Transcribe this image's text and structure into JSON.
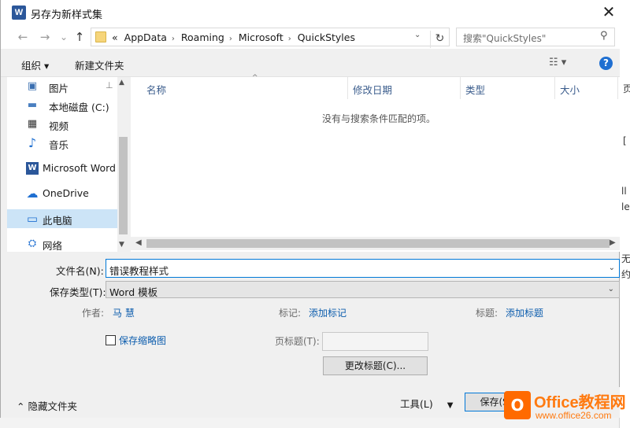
{
  "window": {
    "title": "另存为新样式集",
    "app_icon_letter": "W",
    "close_symbol": "✕"
  },
  "nav": {
    "back": "←",
    "forward": "→",
    "recent": "⌄",
    "up": "↑",
    "crumb_prefix": "«",
    "crumbs": [
      "AppData",
      "Roaming",
      "Microsoft",
      "QuickStyles"
    ],
    "refresh": "↻",
    "search_placeholder": "搜索\"QuickStyles\""
  },
  "toolbar": {
    "organize": "组织 ▾",
    "new_folder": "新建文件夹",
    "view_icon": "☷ ▾",
    "help": "?"
  },
  "sidebar": {
    "items": [
      {
        "label": "图片",
        "icon": "pictures-icon",
        "glyph": "▣"
      },
      {
        "label": "本地磁盘 (C:)",
        "icon": "drive-icon",
        "glyph": "▬"
      },
      {
        "label": "视频",
        "icon": "video-icon",
        "glyph": "▦"
      },
      {
        "label": "音乐",
        "icon": "music-icon",
        "glyph": "♪"
      },
      {
        "label": "Microsoft Word",
        "icon": "word-icon",
        "glyph": "W"
      },
      {
        "label": "OneDrive",
        "icon": "onedrive-icon",
        "glyph": "☁"
      },
      {
        "label": "此电脑",
        "icon": "computer-icon",
        "glyph": "▭"
      },
      {
        "label": "网络",
        "icon": "network-icon",
        "glyph": "⛭"
      }
    ],
    "pin_glyph": "📌"
  },
  "filelist": {
    "columns": [
      "名称",
      "修改日期",
      "类型",
      "大小"
    ],
    "empty_message": "没有与搜索条件匹配的项。"
  },
  "form": {
    "filename_label": "文件名(N):",
    "filename_value": "错误教程样式",
    "filetype_label": "保存类型(T):",
    "filetype_value": "Word 模板",
    "author_label": "作者:",
    "author_value": "马 慧",
    "tags_label": "标记:",
    "tags_value": "添加标记",
    "title_label": "标题:",
    "title_value": "添加标题",
    "thumbnail_label": "保存缩略图",
    "page_title_label": "页标题(T):",
    "change_title_button": "更改标题(C)..."
  },
  "bottom": {
    "hide_folders": "隐藏文件夹",
    "tools": "工具(L)",
    "save": "保存(S)"
  },
  "background": {
    "right_chars": [
      "页",
      "[",
      "ll",
      "le",
      "无",
      "约"
    ]
  },
  "watermark": {
    "logo_letter": "O",
    "text": "Office教程网",
    "url": "www.office26.com"
  }
}
